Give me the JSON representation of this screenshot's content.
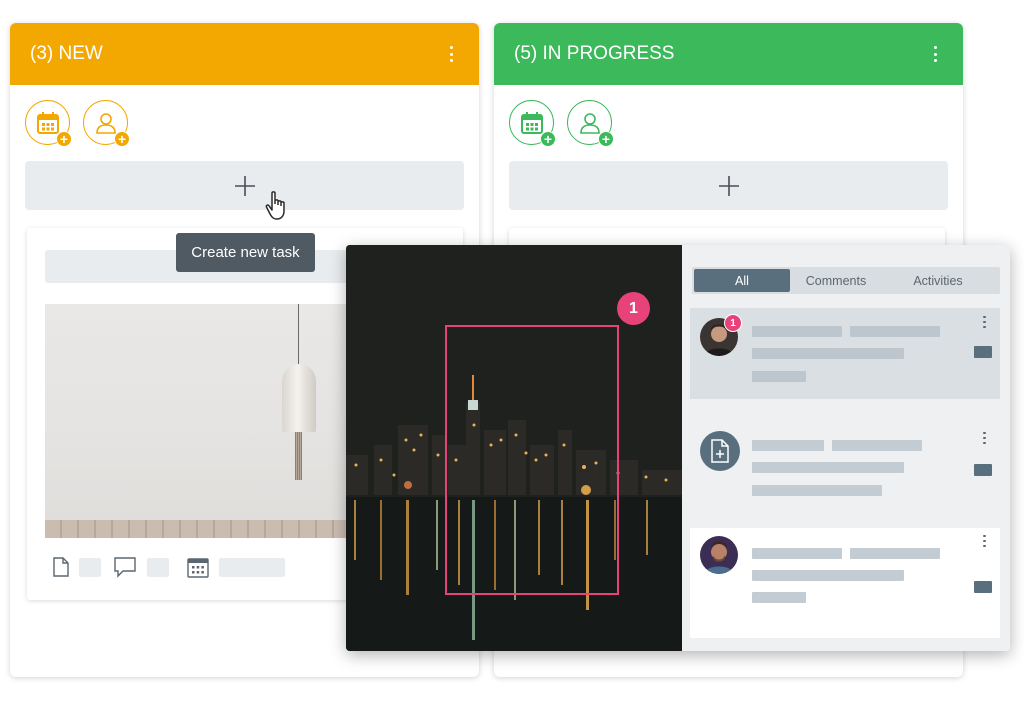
{
  "columns": {
    "new": {
      "title": "(3) NEW",
      "color": "#f2a800"
    },
    "in_progress": {
      "title": "(5) IN PROGRESS",
      "color": "#3cb95b"
    }
  },
  "tooltip": {
    "text": "Create new task"
  },
  "viewer": {
    "marker_number": "1",
    "tabs": [
      {
        "label": "All",
        "active": true
      },
      {
        "label": "Comments",
        "active": false
      },
      {
        "label": "Activities",
        "active": false
      }
    ],
    "entries": [
      {
        "type": "comment",
        "avatar": "man-avatar",
        "badge": "1"
      },
      {
        "type": "document",
        "avatar": "document-add-icon"
      },
      {
        "type": "comment",
        "avatar": "man-avatar-2"
      }
    ]
  },
  "colors": {
    "accent_pink": "#e8427a",
    "slate": "#5a6f7e"
  }
}
